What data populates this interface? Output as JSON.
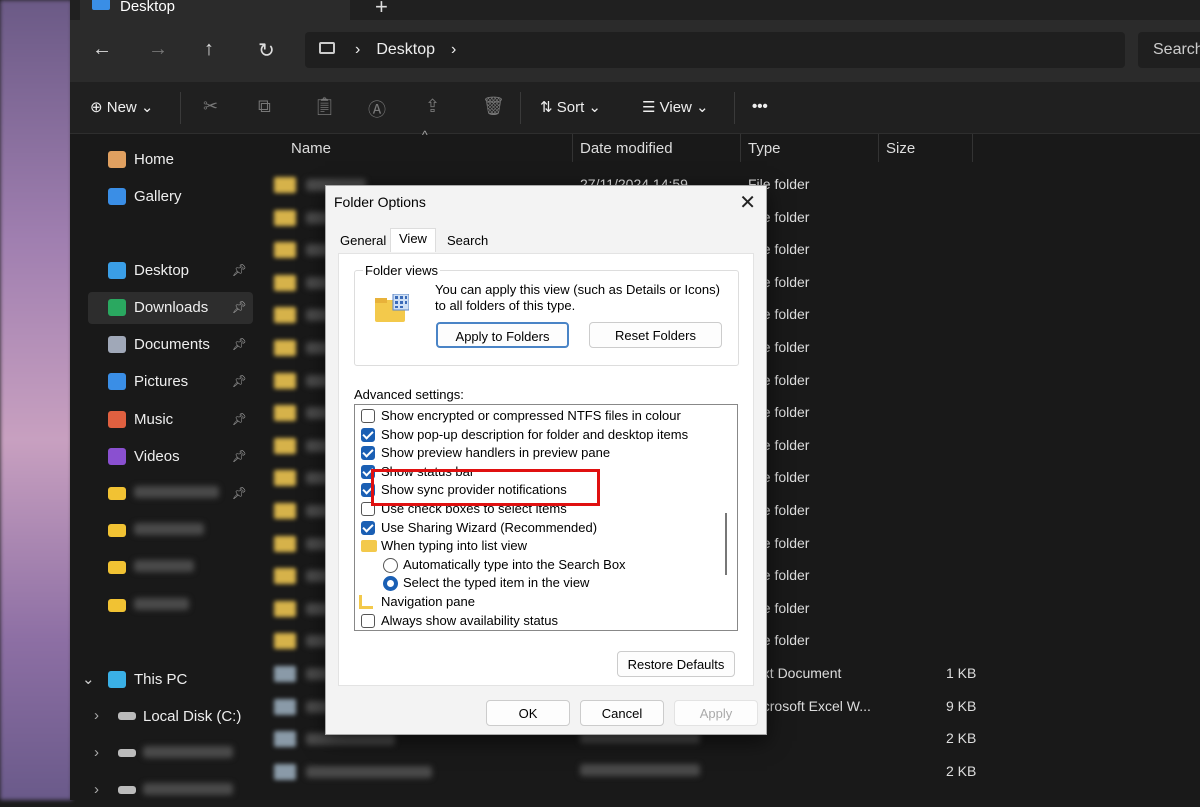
{
  "window": {
    "tab_title": "Desktop",
    "new_tab": "+"
  },
  "nav": {
    "back": "←",
    "forward": "→",
    "up": "↑",
    "refresh": "↻",
    "breadcrumb": [
      "Desktop"
    ],
    "search_placeholder": "Search"
  },
  "toolbar": {
    "new_label": "New",
    "sort_label": "Sort",
    "view_label": "View",
    "more": "•••"
  },
  "sidebar": {
    "items": [
      {
        "label": "Home",
        "color": "#e0a060"
      },
      {
        "label": "Gallery",
        "color": "#3a8ee6"
      },
      {
        "label": "Desktop",
        "color": "#3a9ee6",
        "pinned": true
      },
      {
        "label": "Downloads",
        "color": "#2aa860",
        "pinned": true,
        "selected": true
      },
      {
        "label": "Documents",
        "color": "#a0a8b8",
        "pinned": true
      },
      {
        "label": "Pictures",
        "color": "#3a8ee6",
        "pinned": true
      },
      {
        "label": "Music",
        "color": "#e06040",
        "pinned": true
      },
      {
        "label": "Videos",
        "color": "#8a50d0",
        "pinned": true
      }
    ],
    "this_pc": "This PC",
    "local_disk": "Local Disk (C:)"
  },
  "columns": {
    "name": "Name",
    "date": "Date modified",
    "type": "Type",
    "size": "Size"
  },
  "files": [
    {
      "date": "27/11/2024 14:59",
      "type": "File folder",
      "size": ""
    },
    {
      "type": "File folder"
    },
    {
      "type": "File folder"
    },
    {
      "type": "File folder"
    },
    {
      "type": "File folder"
    },
    {
      "type": "File folder"
    },
    {
      "type": "File folder"
    },
    {
      "type": "File folder"
    },
    {
      "type": "File folder"
    },
    {
      "type": "File folder"
    },
    {
      "type": "File folder"
    },
    {
      "type": "File folder"
    },
    {
      "type": "File folder"
    },
    {
      "type": "File folder"
    },
    {
      "type": "File folder"
    },
    {
      "type": "Text Document",
      "size": "1 KB"
    },
    {
      "type": "Microsoft Excel W...",
      "size": "9 KB"
    },
    {
      "type": "",
      "size": "2 KB"
    },
    {
      "type": "",
      "size": "2 KB"
    }
  ],
  "dialog": {
    "title": "Folder Options",
    "close": "✕",
    "tabs": [
      "General",
      "View",
      "Search"
    ],
    "active_tab": "View",
    "folder_views": {
      "label": "Folder views",
      "description": "You can apply this view (such as Details or Icons) to all folders of this type.",
      "apply": "Apply to Folders",
      "reset": "Reset Folders"
    },
    "advanced_label": "Advanced settings:",
    "settings": [
      {
        "label": "Show encrypted or compressed NTFS files in colour",
        "kind": "checkbox",
        "checked": false
      },
      {
        "label": "Show pop-up description for folder and desktop items",
        "kind": "checkbox",
        "checked": true
      },
      {
        "label": "Show preview handlers in preview pane",
        "kind": "checkbox",
        "checked": true
      },
      {
        "label": "Show status bar",
        "kind": "checkbox",
        "checked": true
      },
      {
        "label": "Show sync provider notifications",
        "kind": "checkbox",
        "checked": true,
        "highlighted": true
      },
      {
        "label": "Use check boxes to select items",
        "kind": "checkbox",
        "checked": false
      },
      {
        "label": "Use Sharing Wizard (Recommended)",
        "kind": "checkbox",
        "checked": true
      },
      {
        "label": "When typing into list view",
        "kind": "folder"
      },
      {
        "label": "Automatically type into the Search Box",
        "kind": "radio",
        "checked": false
      },
      {
        "label": "Select the typed item in the view",
        "kind": "radio",
        "checked": true
      },
      {
        "label": "Navigation pane",
        "kind": "nav"
      },
      {
        "label": "Always show availability status",
        "kind": "checkbox",
        "checked": false
      }
    ],
    "restore": "Restore Defaults",
    "ok": "OK",
    "cancel": "Cancel",
    "apply": "Apply"
  },
  "colors": {
    "highlight": "#e01010",
    "accent": "#1a5fb4"
  }
}
